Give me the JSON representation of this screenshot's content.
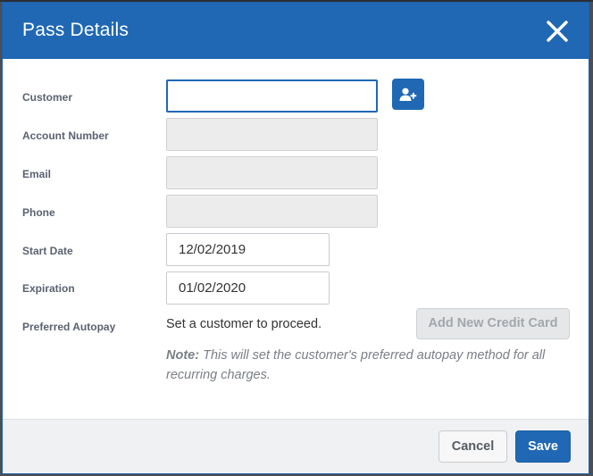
{
  "dialog": {
    "title": "Pass Details",
    "close_icon": "close-icon"
  },
  "form": {
    "customer": {
      "label": "Customer",
      "value": "",
      "add_icon": "add-user-icon"
    },
    "account_number": {
      "label": "Account Number",
      "value": ""
    },
    "email": {
      "label": "Email",
      "value": ""
    },
    "phone": {
      "label": "Phone",
      "value": ""
    },
    "start_date": {
      "label": "Start Date",
      "value": "12/02/2019"
    },
    "expiration": {
      "label": "Expiration",
      "value": "01/02/2020"
    },
    "preferred_autopay": {
      "label": "Preferred Autopay",
      "message": "Set a customer to proceed.",
      "add_card_label": "Add New Credit Card"
    },
    "note": {
      "prefix": "Note:",
      "text": " This will set the customer's preferred autopay method for all recurring charges."
    }
  },
  "footer": {
    "cancel_label": "Cancel",
    "save_label": "Save"
  },
  "colors": {
    "header": "#2068b4",
    "primary_button": "#2068b4",
    "disabled_field": "#ececec"
  }
}
